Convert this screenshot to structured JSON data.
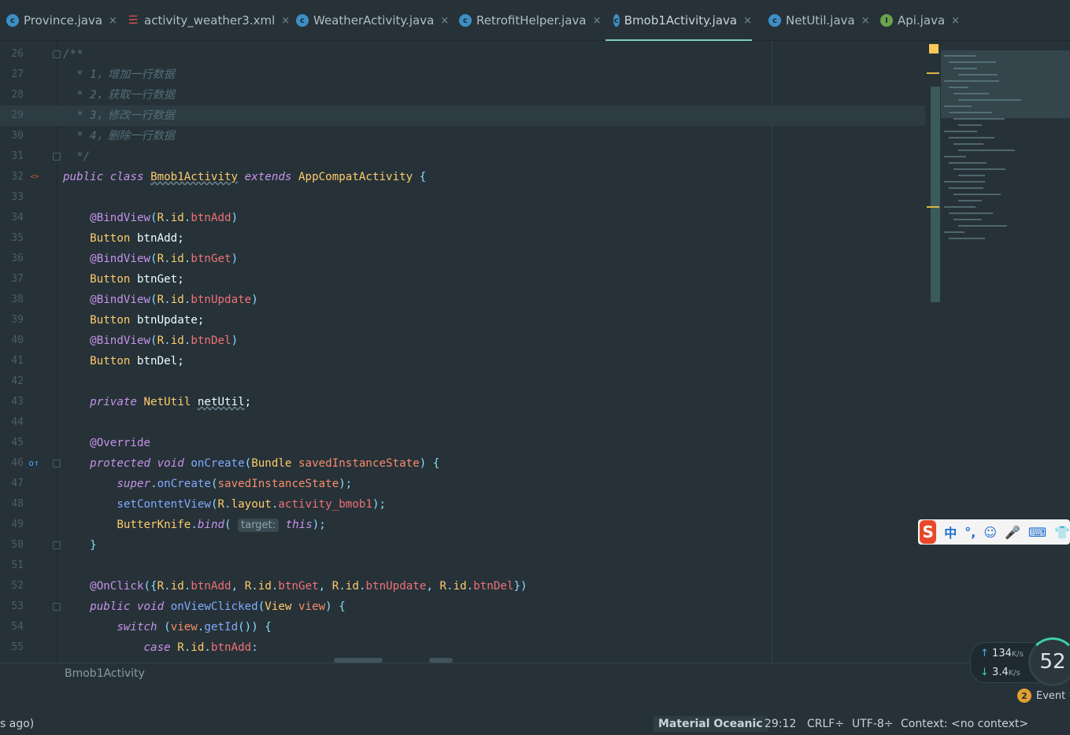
{
  "tabs": [
    {
      "label": "Province.java",
      "icon": "class-icon",
      "glyph": "c"
    },
    {
      "label": "activity_weather3.xml",
      "icon": "xml-layout-icon",
      "glyph": "☰"
    },
    {
      "label": "WeatherActivity.java",
      "icon": "class-icon",
      "glyph": "c"
    },
    {
      "label": "RetrofitHelper.java",
      "icon": "class-icon",
      "glyph": "c"
    },
    {
      "label": "Bmob1Activity.java",
      "icon": "class-icon",
      "glyph": "c",
      "active": true
    },
    {
      "label": "NetUtil.java",
      "icon": "class-icon",
      "glyph": "c"
    },
    {
      "label": "Api.java",
      "icon": "interface-icon",
      "glyph": "I"
    }
  ],
  "tab_close_glyph": "×",
  "editor": {
    "current_line": 29,
    "lines": [
      {
        "n": "26",
        "tokens": [
          [
            "cmt",
            "/**"
          ]
        ]
      },
      {
        "n": "27",
        "tokens": [
          [
            "cmt",
            "  * 1，增加一行数据"
          ]
        ]
      },
      {
        "n": "28",
        "tokens": [
          [
            "cmt",
            "  * 2，获取一行数据"
          ]
        ]
      },
      {
        "n": "29",
        "tokens": [
          [
            "cmt",
            "  * 3，修改一行数据"
          ]
        ]
      },
      {
        "n": "30",
        "tokens": [
          [
            "cmt",
            "  * 4，删除一行数据"
          ]
        ]
      },
      {
        "n": "31",
        "tokens": [
          [
            "cmt",
            "  */"
          ]
        ]
      },
      {
        "n": "32",
        "tokens": [
          [
            "kw",
            "public"
          ],
          [
            "plain",
            " "
          ],
          [
            "kw",
            "class"
          ],
          [
            "plain",
            " "
          ],
          [
            "cls",
            "Bmob1Activity"
          ],
          [
            "plain",
            " "
          ],
          [
            "kw",
            "extends"
          ],
          [
            "plain",
            " "
          ],
          [
            "type",
            "AppCompatActivity"
          ],
          [
            "plain",
            " "
          ],
          [
            "punc",
            "{"
          ]
        ]
      },
      {
        "n": "33",
        "tokens": []
      },
      {
        "n": "34",
        "tokens": [
          [
            "plain",
            "    "
          ],
          [
            "ann",
            "@BindView"
          ],
          [
            "punc",
            "("
          ],
          [
            "type",
            "R"
          ],
          [
            "punc",
            "."
          ],
          [
            "type",
            "id"
          ],
          [
            "punc",
            "."
          ],
          [
            "field",
            "btnAdd"
          ],
          [
            "punc",
            ")"
          ]
        ]
      },
      {
        "n": "35",
        "tokens": [
          [
            "plain",
            "    "
          ],
          [
            "type",
            "Button"
          ],
          [
            "plain",
            " btnAdd;"
          ]
        ]
      },
      {
        "n": "36",
        "tokens": [
          [
            "plain",
            "    "
          ],
          [
            "ann",
            "@BindView"
          ],
          [
            "punc",
            "("
          ],
          [
            "type",
            "R"
          ],
          [
            "punc",
            "."
          ],
          [
            "type",
            "id"
          ],
          [
            "punc",
            "."
          ],
          [
            "field",
            "btnGet"
          ],
          [
            "punc",
            ")"
          ]
        ]
      },
      {
        "n": "37",
        "tokens": [
          [
            "plain",
            "    "
          ],
          [
            "type",
            "Button"
          ],
          [
            "plain",
            " btnGet;"
          ]
        ]
      },
      {
        "n": "38",
        "tokens": [
          [
            "plain",
            "    "
          ],
          [
            "ann",
            "@BindView"
          ],
          [
            "punc",
            "("
          ],
          [
            "type",
            "R"
          ],
          [
            "punc",
            "."
          ],
          [
            "type",
            "id"
          ],
          [
            "punc",
            "."
          ],
          [
            "field",
            "btnUpdate"
          ],
          [
            "punc",
            ")"
          ]
        ]
      },
      {
        "n": "39",
        "tokens": [
          [
            "plain",
            "    "
          ],
          [
            "type",
            "Button"
          ],
          [
            "plain",
            " btnUpdate;"
          ]
        ]
      },
      {
        "n": "40",
        "tokens": [
          [
            "plain",
            "    "
          ],
          [
            "ann",
            "@BindView"
          ],
          [
            "punc",
            "("
          ],
          [
            "type",
            "R"
          ],
          [
            "punc",
            "."
          ],
          [
            "type",
            "id"
          ],
          [
            "punc",
            "."
          ],
          [
            "field",
            "btnDel"
          ],
          [
            "punc",
            ")"
          ]
        ]
      },
      {
        "n": "41",
        "tokens": [
          [
            "plain",
            "    "
          ],
          [
            "type",
            "Button"
          ],
          [
            "plain",
            " btnDel;"
          ]
        ]
      },
      {
        "n": "42",
        "tokens": []
      },
      {
        "n": "43",
        "tokens": [
          [
            "plain",
            "    "
          ],
          [
            "kw",
            "private"
          ],
          [
            "plain",
            " "
          ],
          [
            "type",
            "NetUtil"
          ],
          [
            "plain",
            " "
          ],
          [
            "var",
            "netUtil"
          ],
          [
            "plain",
            ";"
          ]
        ]
      },
      {
        "n": "44",
        "tokens": []
      },
      {
        "n": "45",
        "tokens": [
          [
            "plain",
            "    "
          ],
          [
            "ann",
            "@Override"
          ]
        ]
      },
      {
        "n": "46",
        "tokens": [
          [
            "plain",
            "    "
          ],
          [
            "kw",
            "protected"
          ],
          [
            "plain",
            " "
          ],
          [
            "kw",
            "void"
          ],
          [
            "plain",
            " "
          ],
          [
            "fn",
            "onCreate"
          ],
          [
            "punc",
            "("
          ],
          [
            "type",
            "Bundle"
          ],
          [
            "plain",
            " "
          ],
          [
            "param",
            "savedInstanceState"
          ],
          [
            "punc",
            ")"
          ],
          [
            "plain",
            " "
          ],
          [
            "punc",
            "{"
          ]
        ]
      },
      {
        "n": "47",
        "tokens": [
          [
            "plain",
            "        "
          ],
          [
            "kw",
            "super"
          ],
          [
            "punc",
            "."
          ],
          [
            "fn",
            "onCreate"
          ],
          [
            "punc",
            "("
          ],
          [
            "param",
            "savedInstanceState"
          ],
          [
            "punc",
            ");"
          ]
        ]
      },
      {
        "n": "48",
        "tokens": [
          [
            "plain",
            "        "
          ],
          [
            "fn",
            "setContentView"
          ],
          [
            "punc",
            "("
          ],
          [
            "type",
            "R"
          ],
          [
            "punc",
            "."
          ],
          [
            "type",
            "layout"
          ],
          [
            "punc",
            "."
          ],
          [
            "field",
            "activity_bmob1"
          ],
          [
            "punc",
            ");"
          ]
        ]
      },
      {
        "n": "49",
        "tokens": [
          [
            "plain",
            "        "
          ],
          [
            "type",
            "ButterKnife"
          ],
          [
            "punc",
            "."
          ],
          [
            "kw",
            "bind"
          ],
          [
            "punc",
            "("
          ],
          [
            "plain",
            " "
          ],
          [
            "hint",
            "target:"
          ],
          [
            "plain",
            " "
          ],
          [
            "kw",
            "this"
          ],
          [
            "punc",
            ");"
          ]
        ]
      },
      {
        "n": "50",
        "tokens": [
          [
            "plain",
            "    "
          ],
          [
            "punc",
            "}"
          ]
        ]
      },
      {
        "n": "51",
        "tokens": []
      },
      {
        "n": "52",
        "tokens": [
          [
            "plain",
            "    "
          ],
          [
            "ann",
            "@OnClick"
          ],
          [
            "punc",
            "({"
          ],
          [
            "type",
            "R"
          ],
          [
            "punc",
            "."
          ],
          [
            "type",
            "id"
          ],
          [
            "punc",
            "."
          ],
          [
            "field",
            "btnAdd"
          ],
          [
            "punc",
            ", "
          ],
          [
            "type",
            "R"
          ],
          [
            "punc",
            "."
          ],
          [
            "type",
            "id"
          ],
          [
            "punc",
            "."
          ],
          [
            "field",
            "btnGet"
          ],
          [
            "punc",
            ", "
          ],
          [
            "type",
            "R"
          ],
          [
            "punc",
            "."
          ],
          [
            "type",
            "id"
          ],
          [
            "punc",
            "."
          ],
          [
            "field",
            "btnUpdate"
          ],
          [
            "punc",
            ", "
          ],
          [
            "type",
            "R"
          ],
          [
            "punc",
            "."
          ],
          [
            "type",
            "id"
          ],
          [
            "punc",
            "."
          ],
          [
            "field",
            "btnDel"
          ],
          [
            "punc",
            "})"
          ]
        ]
      },
      {
        "n": "53",
        "tokens": [
          [
            "plain",
            "    "
          ],
          [
            "kw",
            "public"
          ],
          [
            "plain",
            " "
          ],
          [
            "kw",
            "void"
          ],
          [
            "plain",
            " "
          ],
          [
            "fn",
            "onViewClicked"
          ],
          [
            "punc",
            "("
          ],
          [
            "type",
            "View"
          ],
          [
            "plain",
            " "
          ],
          [
            "param",
            "view"
          ],
          [
            "punc",
            ")"
          ],
          [
            "plain",
            " "
          ],
          [
            "punc",
            "{"
          ]
        ]
      },
      {
        "n": "54",
        "tokens": [
          [
            "plain",
            "        "
          ],
          [
            "kw",
            "switch"
          ],
          [
            "plain",
            " "
          ],
          [
            "punc",
            "("
          ],
          [
            "param",
            "view"
          ],
          [
            "punc",
            "."
          ],
          [
            "fn",
            "getId"
          ],
          [
            "punc",
            "())"
          ],
          [
            "plain",
            " "
          ],
          [
            "punc",
            "{"
          ]
        ]
      },
      {
        "n": "55",
        "tokens": [
          [
            "plain",
            "            "
          ],
          [
            "kw",
            "case"
          ],
          [
            "plain",
            " "
          ],
          [
            "type",
            "R"
          ],
          [
            "punc",
            "."
          ],
          [
            "type",
            "id"
          ],
          [
            "punc",
            "."
          ],
          [
            "field",
            "btnAdd"
          ],
          [
            "punc",
            ":"
          ]
        ]
      }
    ]
  },
  "gutter_icons": {
    "class_marker": "<>",
    "override_marker": "o↑"
  },
  "breadcrumb": "Bmob1Activity",
  "status": {
    "left_text": "s ago)",
    "theme": "Material Oceanic",
    "position": "29:12",
    "line_ending": "CRLF÷",
    "encoding": "UTF-8÷",
    "context": "Context: <no context>"
  },
  "ime": {
    "logo": "S",
    "items": [
      "中",
      "°,",
      "☺",
      "🎤",
      "⌨",
      "👕"
    ]
  },
  "network": {
    "upload_value": "134",
    "upload_unit": "K/s",
    "download_value": "3.4",
    "download_unit": "K/s",
    "gauge_value": "52",
    "upload_arrow": "↑",
    "download_arrow": "↓"
  },
  "event_log": {
    "count": "2",
    "label": "Event"
  },
  "colors": {
    "background": "#263238",
    "accent": "#80cbc4",
    "keyword": "#c792ea",
    "type": "#ffcb6b",
    "function": "#82aaff",
    "field": "#f07178",
    "comment": "#546e7a"
  }
}
